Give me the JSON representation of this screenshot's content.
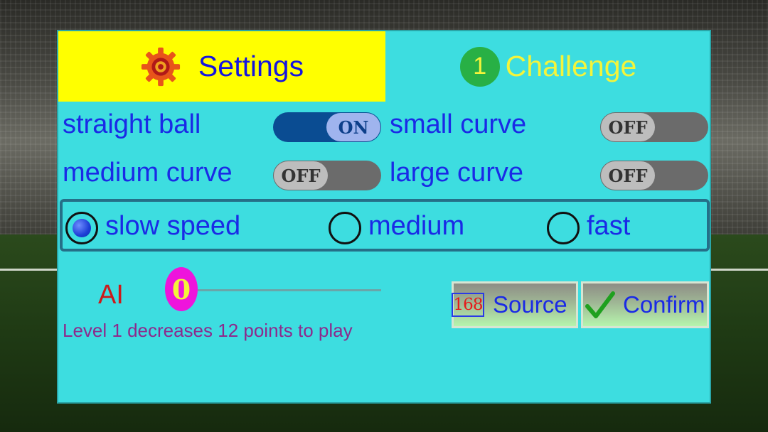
{
  "tabs": {
    "settings_label": "Settings",
    "challenge_badge": "1",
    "challenge_label": "Challenge"
  },
  "options": {
    "straight_ball": {
      "label": "straight ball",
      "state": "ON"
    },
    "small_curve": {
      "label": "small curve",
      "state": "OFF"
    },
    "medium_curve": {
      "label": "medium curve",
      "state": "OFF"
    },
    "large_curve": {
      "label": "large curve",
      "state": "OFF"
    }
  },
  "speed": {
    "options": [
      "slow speed",
      "medium",
      "fast"
    ],
    "selected": "slow speed"
  },
  "ai": {
    "label": "AI",
    "value": "0",
    "info": "Level 1 decreases 12 points to play"
  },
  "buttons": {
    "source_icon_text": "168",
    "source_label": "Source",
    "confirm_label": "Confirm"
  },
  "colors": {
    "panel": "#3ddde0",
    "tab_active": "#ffff00",
    "label_blue": "#1a2ae6",
    "toggle_on": "#0a4c92",
    "toggle_off": "#6b6b6b",
    "ai_red": "#cc1a1a",
    "slider_thumb": "#ee14dc",
    "info_purple": "#8c2a8c"
  }
}
